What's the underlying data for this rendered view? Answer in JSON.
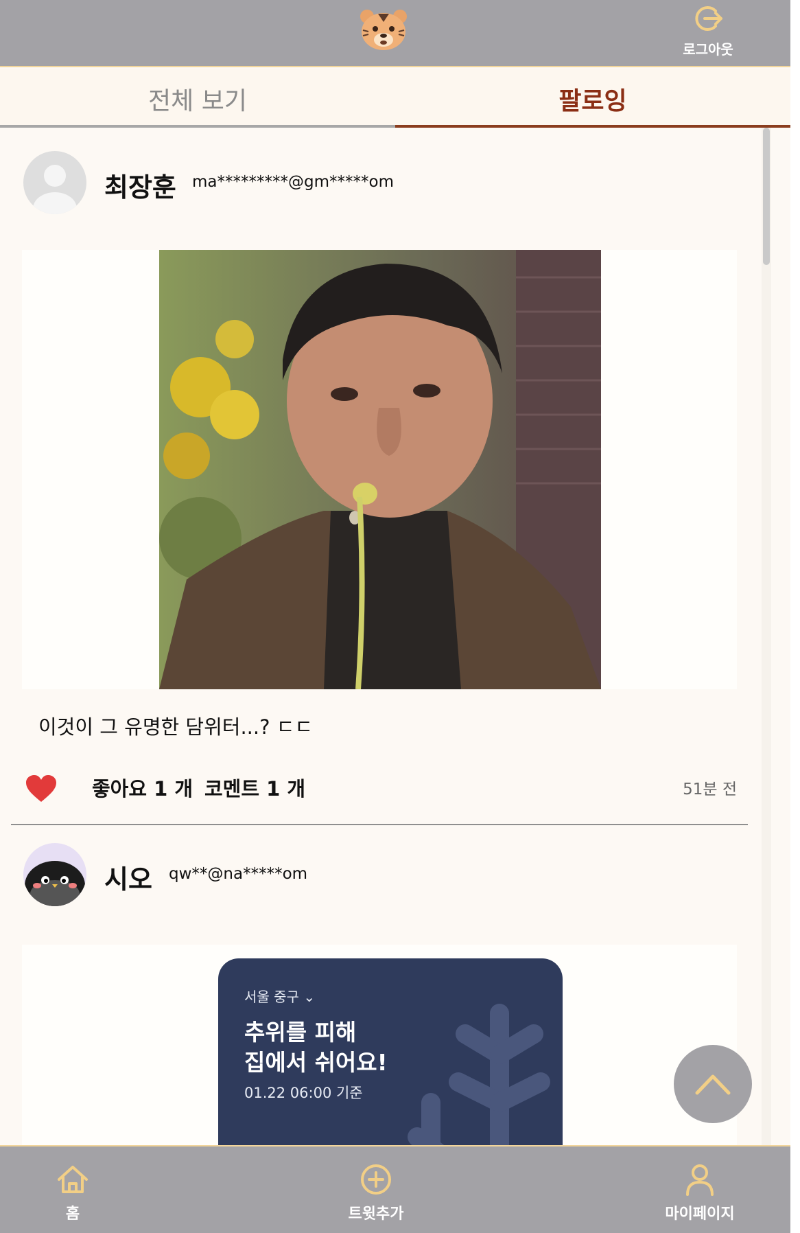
{
  "header": {
    "logo_icon": "tiger-face-icon",
    "logout_label": "로그아웃",
    "logout_icon": "logout-icon"
  },
  "tabs": [
    {
      "label": "전체 보기",
      "active": false
    },
    {
      "label": "팔로잉",
      "active": true
    }
  ],
  "posts": [
    {
      "author": "최장훈",
      "email": "ma*********@gm*****om",
      "avatar": "default-avatar-icon",
      "caption": "이것이 그 유명한 담위터...? ㄷㄷ",
      "likes_label": "좋아요 1 개",
      "comments_label": "코멘트 1 개",
      "time": "51분 전",
      "liked": true
    },
    {
      "author": "시오",
      "email": "qw**@na*****om",
      "avatar": "penguin-avatar-icon",
      "weather": {
        "location": "서울 중구",
        "message": "추위를 피해\n집에서 쉬어요!",
        "time": "01.22 06:00 기준"
      }
    }
  ],
  "nav": {
    "home": "홈",
    "tweet": "트윗추가",
    "mypage": "마이페이지"
  },
  "colors": {
    "bar": "#a3a2a6",
    "accent": "#f2cf86",
    "active_tab": "#8b2e14",
    "background": "#fdf9f4",
    "heart": "#e23a3a"
  }
}
